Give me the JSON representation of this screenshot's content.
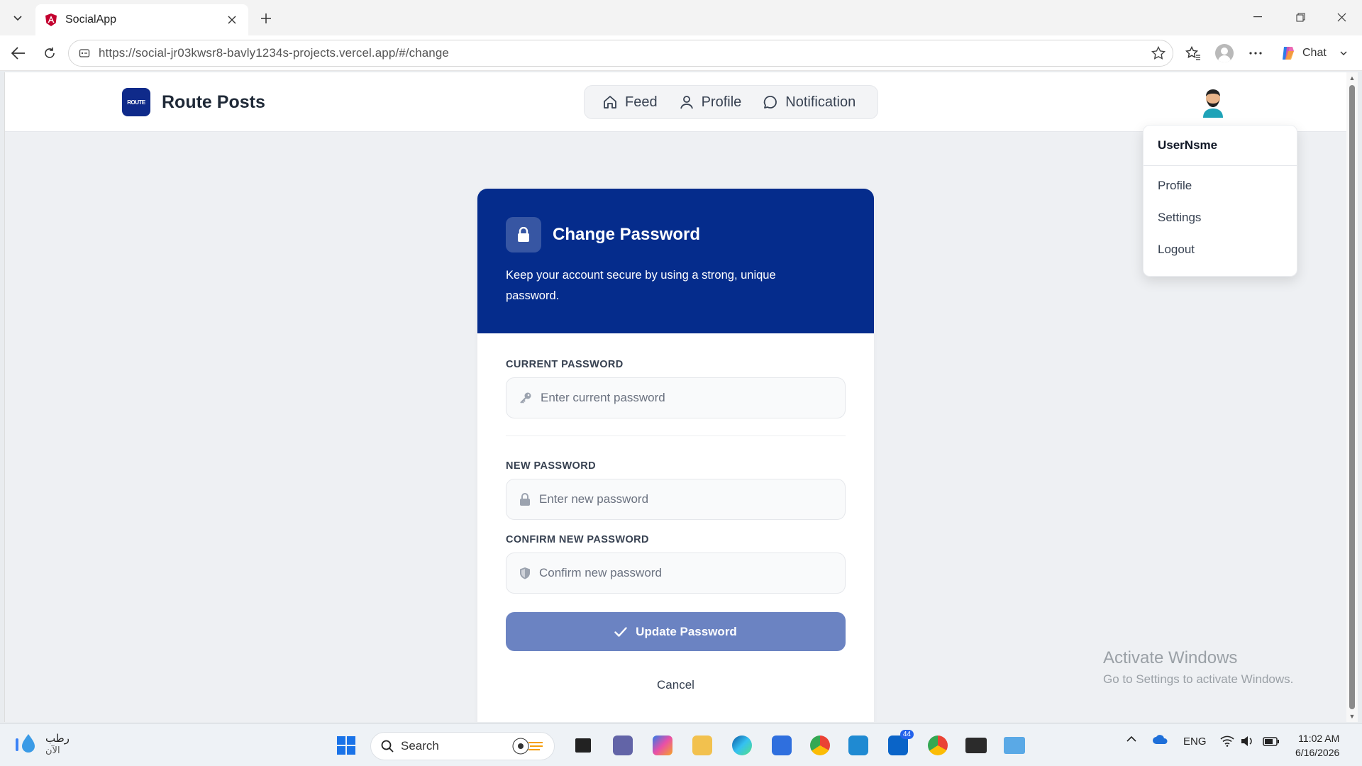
{
  "browser": {
    "tab_title": "SocialApp",
    "url": "https://social-jr03kwsr8-bavly1234s-projects.vercel.app/#/change",
    "chat_label": "Chat"
  },
  "app": {
    "brand_logo_text": "ROUTE",
    "brand_name": "Route Posts",
    "nav": [
      {
        "label": "Feed"
      },
      {
        "label": "Profile"
      },
      {
        "label": "Notification"
      }
    ],
    "dropdown": {
      "username": "UserNsme",
      "items": [
        "Profile",
        "Settings",
        "Logout"
      ]
    }
  },
  "change_password": {
    "title": "Change Password",
    "description": "Keep your account secure by using a strong, unique password.",
    "current": {
      "label": "CURRENT PASSWORD",
      "placeholder": "Enter current password"
    },
    "new": {
      "label": "NEW PASSWORD",
      "placeholder": "Enter new password"
    },
    "confirm": {
      "label": "CONFIRM NEW PASSWORD",
      "placeholder": "Confirm new password"
    },
    "submit_label": "Update Password",
    "cancel_label": "Cancel"
  },
  "watermark": {
    "line1": "Activate Windows",
    "line2": "Go to Settings to activate Windows."
  },
  "taskbar": {
    "weather_line1": "رطب",
    "weather_line2": "الآن",
    "search_label": "Search",
    "edge_badge": "44",
    "language": "ENG",
    "time": "11:02 AM",
    "date": "6/16/2026"
  },
  "colors": {
    "header_blue": "#052c8c",
    "button_blue": "#6b83c2",
    "brand_logo": "#0f2a8a"
  }
}
